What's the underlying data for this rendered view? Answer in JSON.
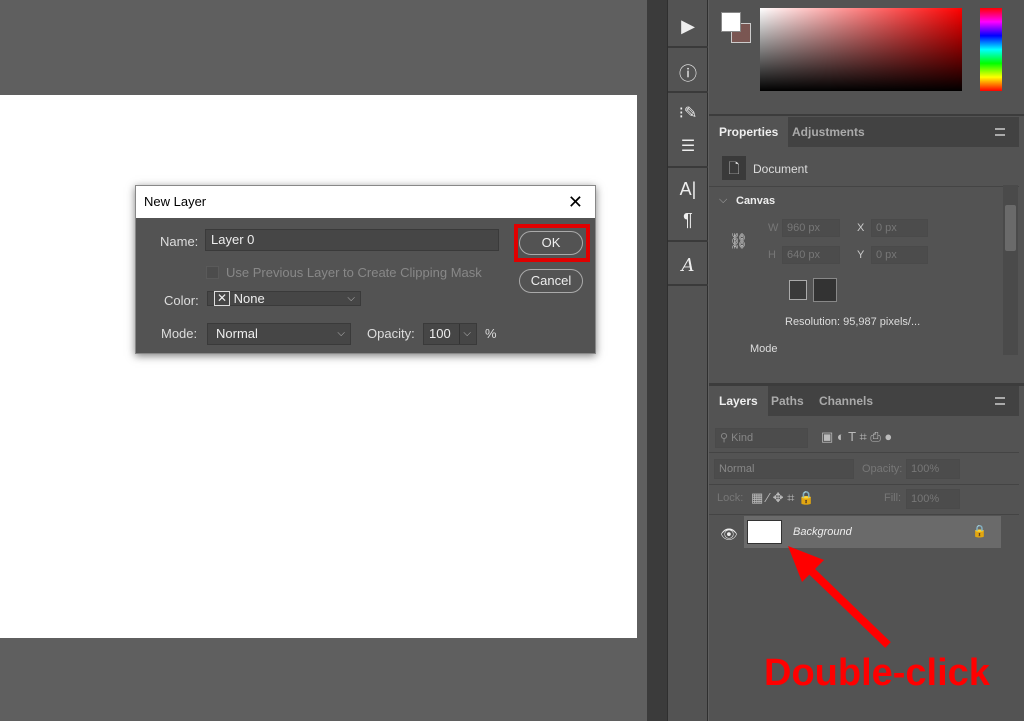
{
  "dialog": {
    "title": "New Layer",
    "name_label": "Name:",
    "name_value": "Layer 0",
    "clip_label": "Use Previous Layer to Create Clipping Mask",
    "color_label": "Color:",
    "color_value": "None",
    "mode_label": "Mode:",
    "mode_value": "Normal",
    "opacity_label": "Opacity:",
    "opacity_value": "100",
    "percent": "%",
    "ok": "OK",
    "cancel": "Cancel"
  },
  "properties": {
    "tabs": [
      "Properties",
      "Adjustments"
    ],
    "document": "Document",
    "section": "Canvas",
    "w_label": "W",
    "w": "960 px",
    "h_label": "H",
    "h": "640 px",
    "x_label": "X",
    "x": "0 px",
    "y_label": "Y",
    "y": "0 px",
    "resolution": "Resolution: 95,987 pixels/...",
    "mode": "Mode"
  },
  "layers": {
    "tabs": [
      "Layers",
      "Paths",
      "Channels"
    ],
    "kind": "Kind",
    "blend": "Normal",
    "opacity_label": "Opacity:",
    "opacity": "100%",
    "lock_label": "Lock:",
    "fill_label": "Fill:",
    "fill": "100%",
    "items": [
      {
        "name": "Background"
      }
    ]
  },
  "annotation": {
    "text": "Double-click",
    "color": "#ff0000"
  }
}
